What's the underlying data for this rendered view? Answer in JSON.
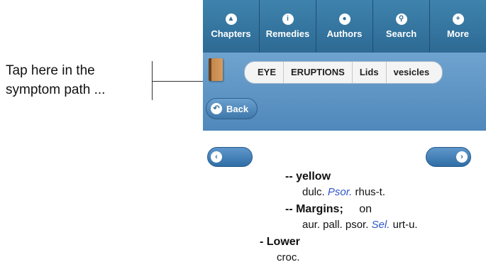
{
  "annotation": {
    "line1": "Tap here in the",
    "line2": "symptom path ..."
  },
  "toolbar": {
    "items": [
      {
        "label": "Chapters",
        "icon": "chapters-icon"
      },
      {
        "label": "Remedies",
        "icon": "info-icon"
      },
      {
        "label": "Authors",
        "icon": "person-icon"
      },
      {
        "label": "Search",
        "icon": "search-icon"
      },
      {
        "label": "More",
        "icon": "plus-icon"
      }
    ]
  },
  "breadcrumb": [
    "EYE",
    "ERUPTIONS",
    "Lids",
    "vesicles"
  ],
  "back_label": "Back",
  "content": {
    "rubric1": "-- yellow",
    "rem1_a": "dulc. ",
    "rem1_b": "Psor.",
    "rem1_c": " rhus-t.",
    "rubric2": "-- Margins;",
    "rubric2_suffix": "on",
    "rem2_a": "aur. pall. psor. ",
    "rem2_b": "Sel.",
    "rem2_c": " urt-u.",
    "rubric3": "-  Lower",
    "rem3": "croc."
  },
  "colors": {
    "toolbar": "#2f6d98",
    "subbar": "#5f95c4",
    "remedy_link": "#2e57c8"
  }
}
